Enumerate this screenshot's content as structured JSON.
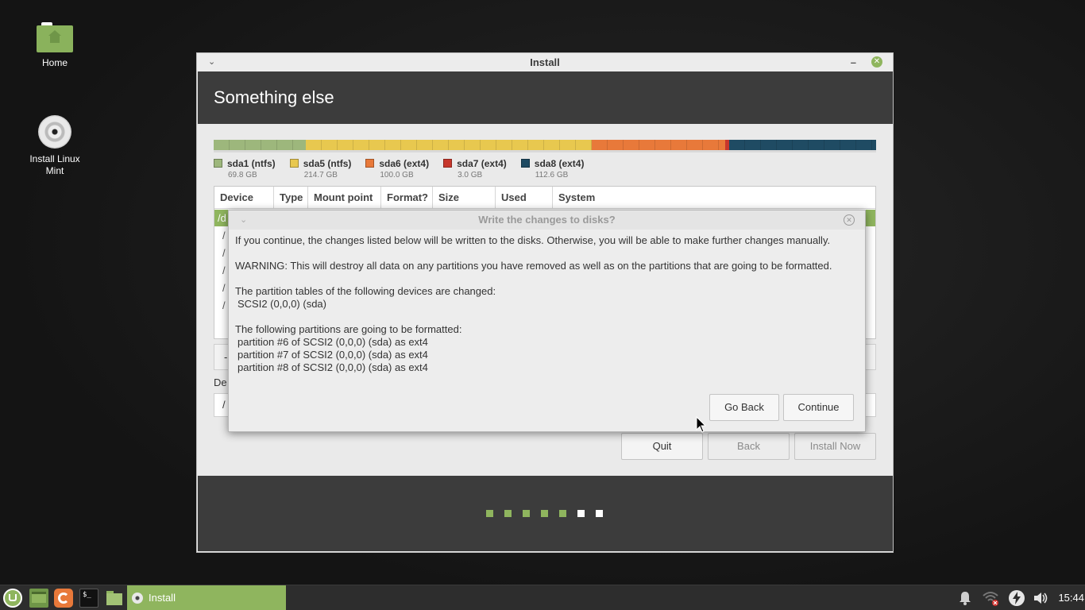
{
  "desktop": {
    "icons": [
      {
        "label": "Home"
      },
      {
        "label": "Install Linux Mint"
      }
    ]
  },
  "window": {
    "title": "Install",
    "header": "Something else",
    "partitions": [
      {
        "name": "sda1 (ntfs)",
        "size": "69.8 GB",
        "color": "#9db77c"
      },
      {
        "name": "sda5 (ntfs)",
        "size": "214.7 GB",
        "color": "#e8c84f"
      },
      {
        "name": "sda6 (ext4)",
        "size": "100.0 GB",
        "color": "#e8793a"
      },
      {
        "name": "sda7 (ext4)",
        "size": "3.0 GB",
        "color": "#c7372c"
      },
      {
        "name": "sda8 (ext4)",
        "size": "112.6 GB",
        "color": "#1f4b63"
      }
    ],
    "table": {
      "columns": [
        "Device",
        "Type",
        "Mount point",
        "Format?",
        "Size",
        "Used",
        "System"
      ],
      "selected_row": "/d",
      "rows": [
        "/",
        "/",
        "/",
        "/",
        "/"
      ]
    },
    "toolbar_symbol": "-",
    "boot_label": "De",
    "boot_value": "/",
    "buttons": {
      "quit": "Quit",
      "back": "Back",
      "install_now": "Install Now"
    },
    "progress_dots": {
      "total": 7,
      "done": 5,
      "done_color": "#8fb55e",
      "todo_color": "#ffffff"
    }
  },
  "dialog": {
    "title": "Write the changes to disks?",
    "intro": "If you continue, the changes listed below will be written to the disks. Otherwise, you will be able to make further changes manually.",
    "warning": "WARNING: This will destroy all data on any partitions you have removed as well as on the partitions that are going to be formatted.",
    "tables_heading": "The partition tables of the following devices are changed:",
    "tables_device": "SCSI2 (0,0,0) (sda)",
    "format_heading": "The following partitions are going to be formatted:",
    "format_items": [
      "partition #6 of SCSI2 (0,0,0) (sda) as ext4",
      "partition #7 of SCSI2 (0,0,0) (sda) as ext4",
      "partition #8 of SCSI2 (0,0,0) (sda) as ext4"
    ],
    "go_back": "Go Back",
    "continue": "Continue"
  },
  "panel": {
    "task_label": "Install",
    "clock": "15:44",
    "accent": "#8fb55e"
  }
}
